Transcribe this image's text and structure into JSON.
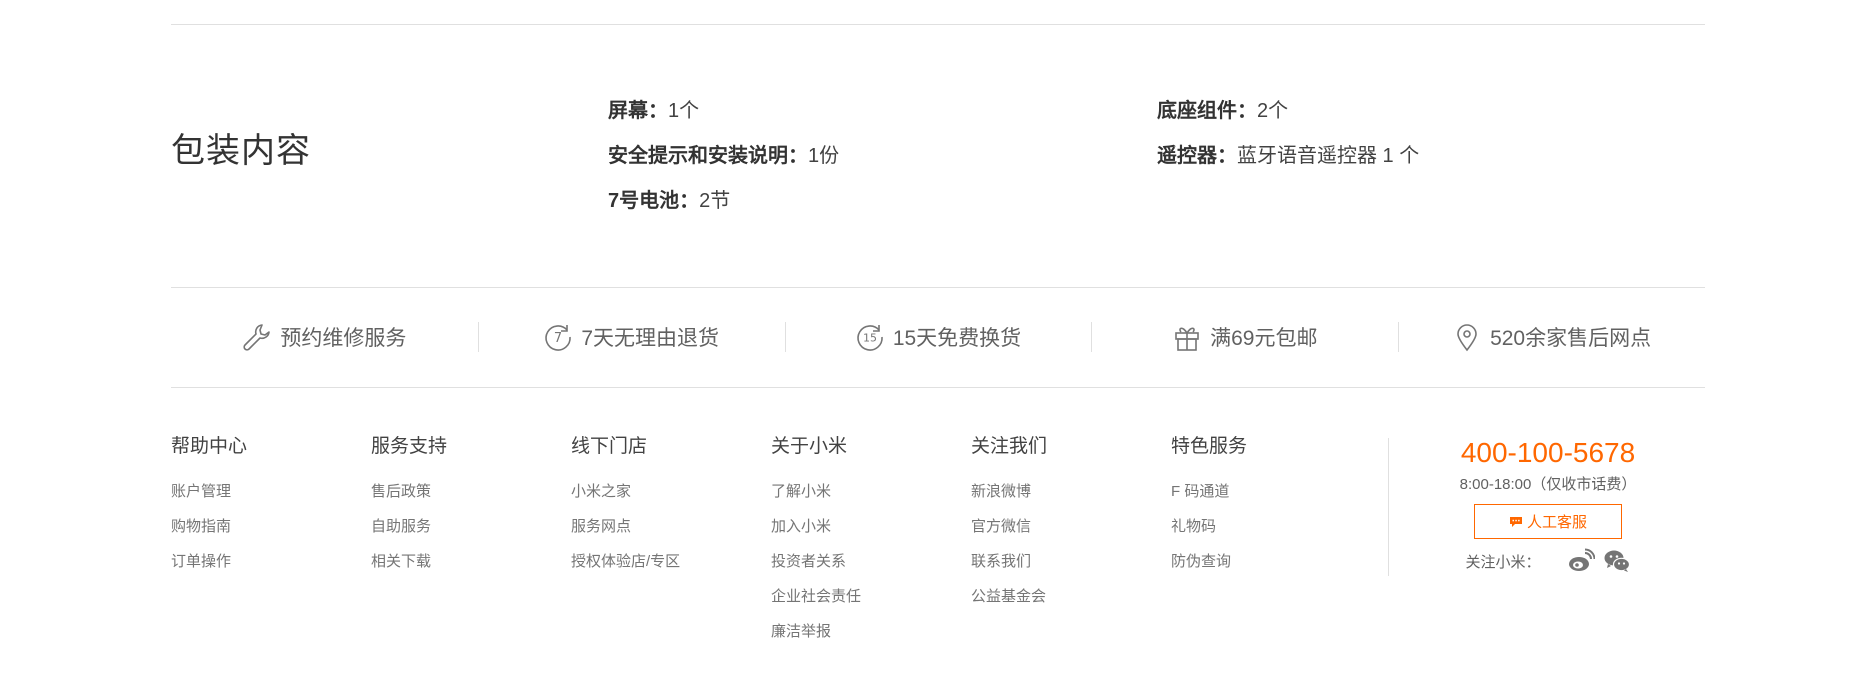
{
  "package": {
    "title": "包装内容",
    "left_items": [
      {
        "label": "屏幕：",
        "value": "1个"
      },
      {
        "label": "安全提示和安装说明：",
        "value": "1份"
      },
      {
        "label": "7号电池：",
        "value": "2节"
      }
    ],
    "right_items": [
      {
        "label": "底座组件：",
        "value": "2个"
      },
      {
        "label": "遥控器：",
        "value": "蓝牙语音遥控器 1 个"
      }
    ]
  },
  "services": [
    {
      "icon": "wrench-icon",
      "label": "预约维修服务"
    },
    {
      "icon": "seven-day-icon",
      "label": "7天无理由退货"
    },
    {
      "icon": "fifteen-day-icon",
      "label": "15天免费换货"
    },
    {
      "icon": "gift-icon",
      "label": "满69元包邮"
    },
    {
      "icon": "location-pin-icon",
      "label": "520余家售后网点"
    }
  ],
  "footer": {
    "columns": [
      {
        "title": "帮助中心",
        "links": [
          "账户管理",
          "购物指南",
          "订单操作"
        ]
      },
      {
        "title": "服务支持",
        "links": [
          "售后政策",
          "自助服务",
          "相关下载"
        ]
      },
      {
        "title": "线下门店",
        "links": [
          "小米之家",
          "服务网点",
          "授权体验店/专区"
        ]
      },
      {
        "title": "关于小米",
        "links": [
          "了解小米",
          "加入小米",
          "投资者关系",
          "企业社会责任",
          "廉洁举报"
        ]
      },
      {
        "title": "关注我们",
        "links": [
          "新浪微博",
          "官方微信",
          "联系我们",
          "公益基金会"
        ]
      },
      {
        "title": "特色服务",
        "links": [
          "F 码通道",
          "礼物码",
          "防伪查询"
        ]
      }
    ],
    "contact": {
      "phone": "400-100-5678",
      "hours": "8:00-18:00（仅收市话费）",
      "chat_button": "人工客服",
      "follow_label": "关注小米：",
      "social_icons": [
        "weibo-icon",
        "wechat-icon"
      ]
    }
  },
  "colors": {
    "accent": "#ff6700",
    "divider": "#e0e0e0",
    "text": "#424242",
    "muted": "#757575"
  }
}
